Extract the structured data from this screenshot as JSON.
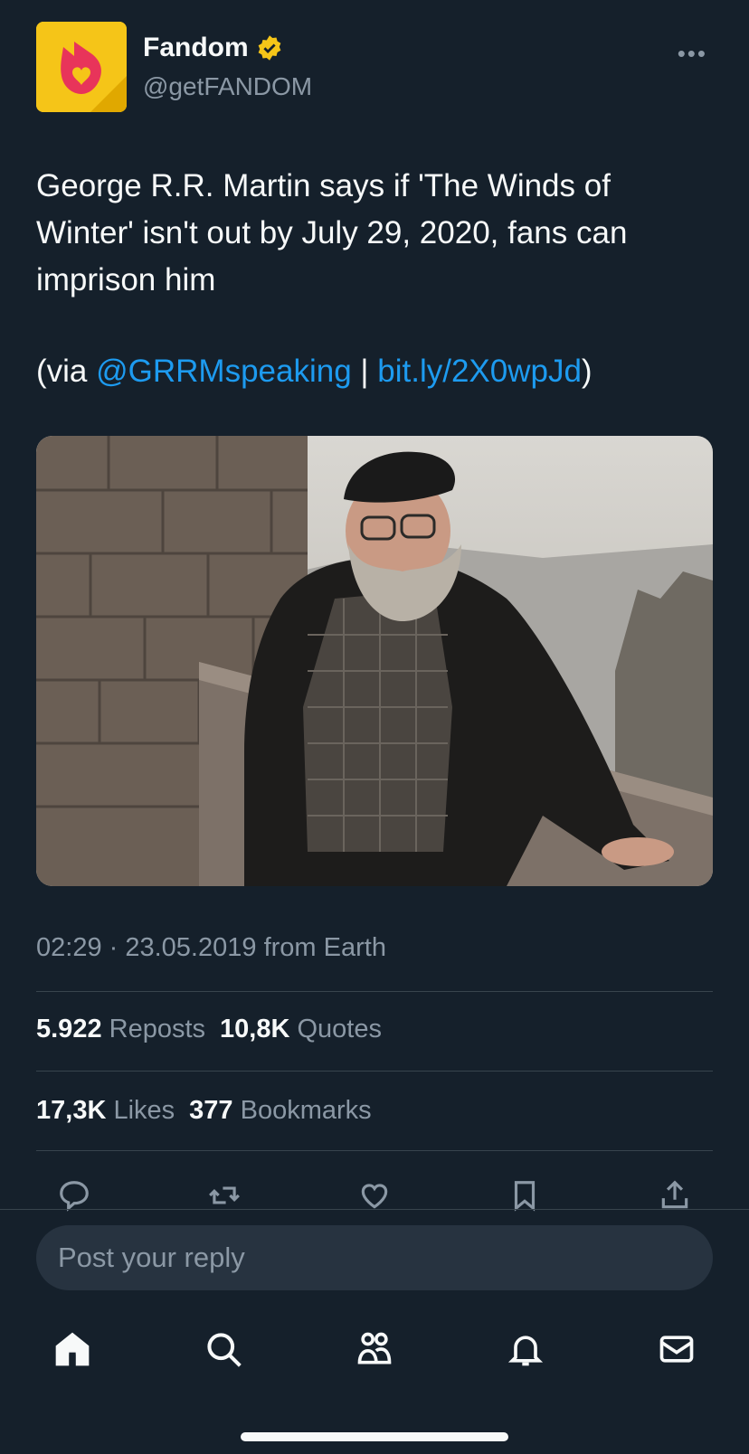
{
  "account": {
    "name": "Fandom",
    "handle": "@getFANDOM",
    "verified_color": "#f5c518",
    "avatar_bg": "#f5c518",
    "logo_color": "#e8345a"
  },
  "tweet": {
    "text": "George R.R. Martin says if 'The Winds of Winter' isn't out by July 29, 2020, fans can imprison him",
    "via_prefix": "(via ",
    "mention": "@GRRMspeaking",
    "divider": " | ",
    "link": "bit.ly/2X0wpJd",
    "via_suffix": ")",
    "link_color": "#1d9bf0"
  },
  "meta": {
    "time": "02:29",
    "dot": " · ",
    "date": "23.05.2019",
    "source": " from Earth"
  },
  "stats": {
    "reposts_count": "5.922",
    "reposts_label": "Reposts",
    "quotes_count": "10,8K",
    "quotes_label": "Quotes",
    "likes_count": "17,3K",
    "likes_label": "Likes",
    "bookmarks_count": "377",
    "bookmarks_label": "Bookmarks"
  },
  "actions": [
    "reply-icon",
    "repost-icon",
    "like-icon",
    "bookmark-icon",
    "share-icon"
  ],
  "reply_box": {
    "placeholder": "Post your reply"
  },
  "bottom_nav": [
    "home-icon",
    "search-icon",
    "communities-icon",
    "notifications-icon",
    "messages-icon"
  ]
}
